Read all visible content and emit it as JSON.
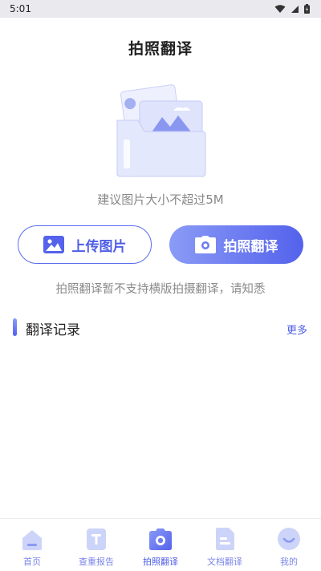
{
  "status_bar": {
    "time": "5:01"
  },
  "page": {
    "title": "拍照翻译",
    "size_hint": "建议图片大小不超过5M",
    "notice": "拍照翻译暂不支持横版拍摄翻译，请知悉"
  },
  "actions": {
    "upload_label": "上传图片",
    "upload_icon": "image-icon",
    "photo_label": "拍照翻译",
    "photo_icon": "camera-icon"
  },
  "history": {
    "title": "翻译记录",
    "more": "更多"
  },
  "tab_bar": {
    "items": [
      {
        "label": "首页",
        "icon": "home-icon"
      },
      {
        "label": "查重报告",
        "icon": "report-icon"
      },
      {
        "label": "拍照翻译",
        "icon": "camera-icon",
        "active": true
      },
      {
        "label": "文档翻译",
        "icon": "document-icon"
      },
      {
        "label": "我的",
        "icon": "smile-icon"
      }
    ]
  },
  "colors": {
    "accent": "#5462ec",
    "accent_light": "#8a9bf6",
    "tab_icon_bg": "#cdd4fa"
  }
}
